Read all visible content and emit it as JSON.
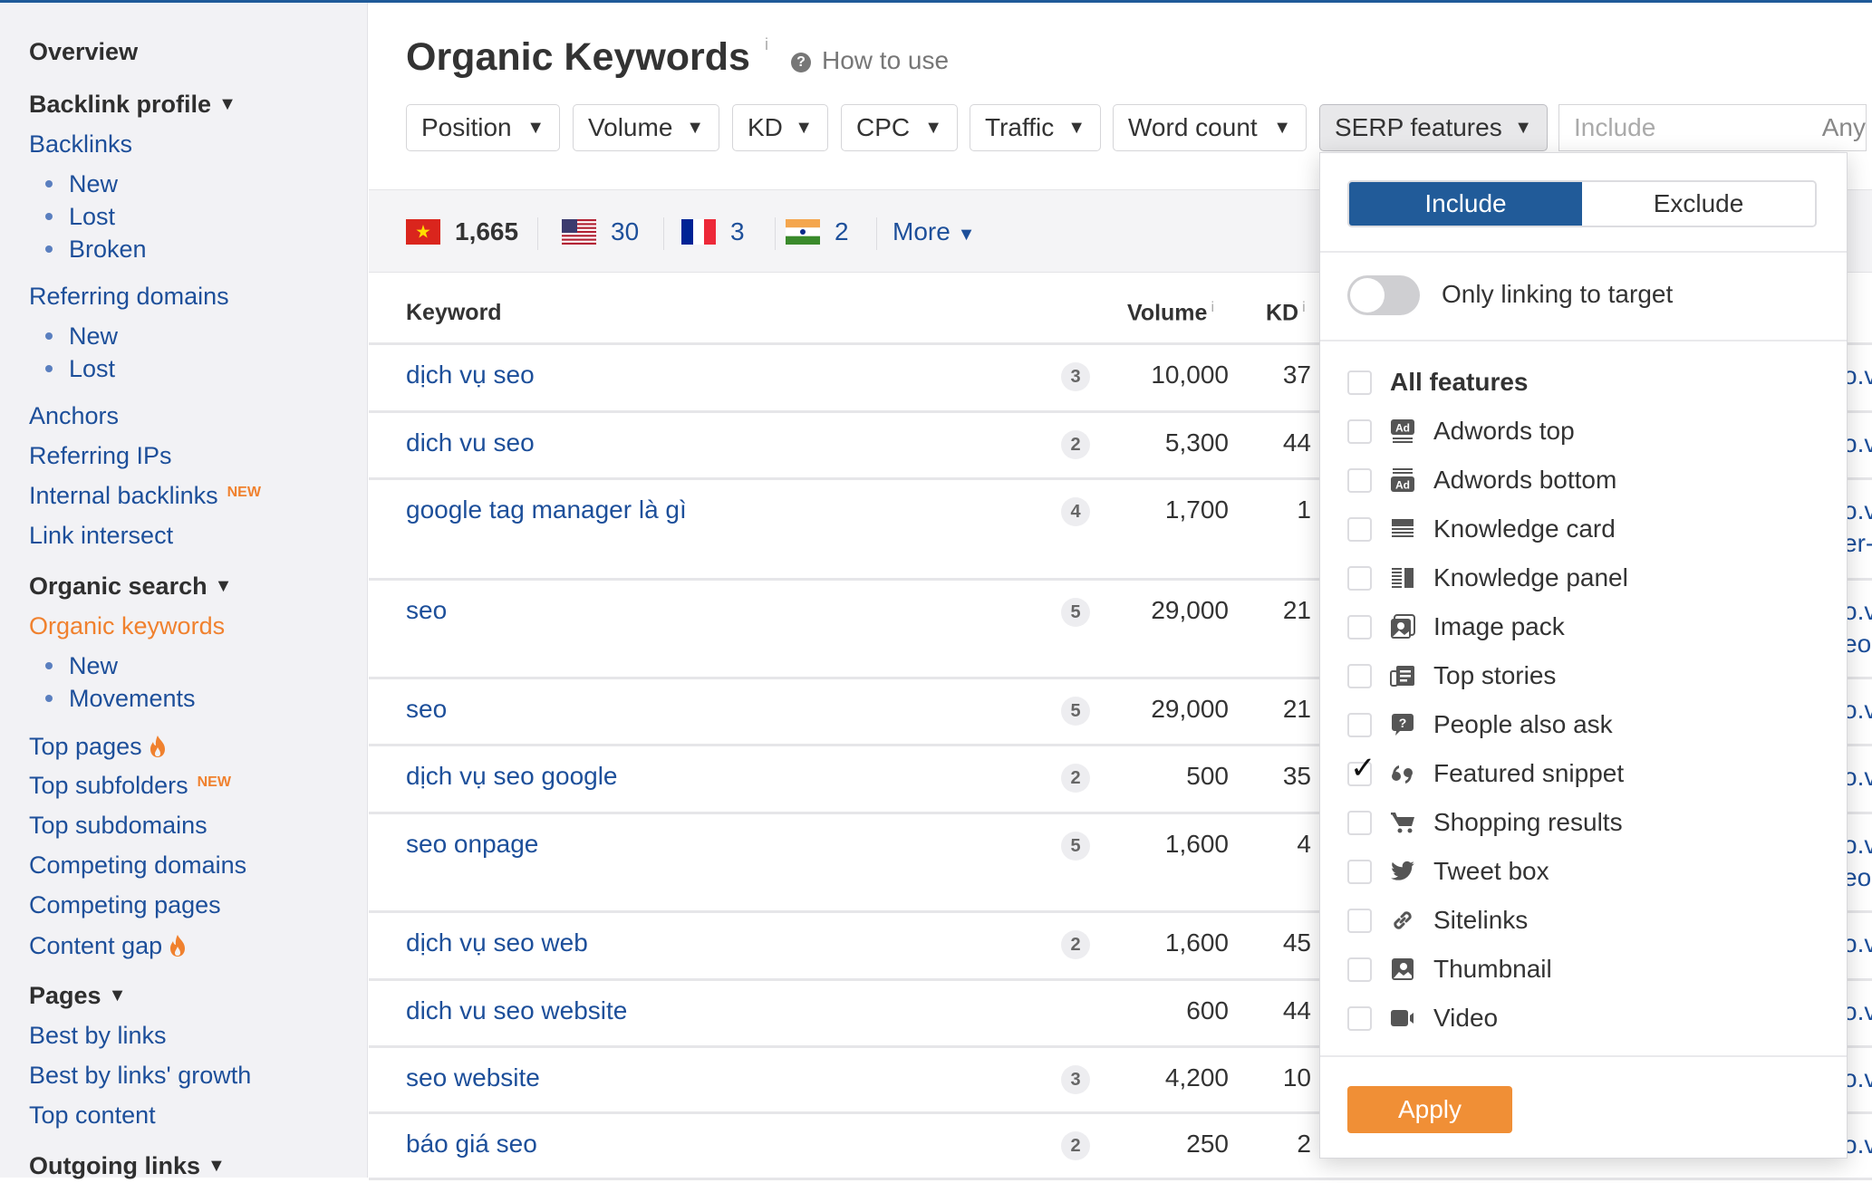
{
  "sidebar": {
    "overview": "Overview",
    "backlink_profile": "Backlink profile",
    "backlinks": "Backlinks",
    "backlinks_sub": [
      "New",
      "Lost",
      "Broken"
    ],
    "referring_domains": "Referring domains",
    "referring_domains_sub": [
      "New",
      "Lost"
    ],
    "anchors": "Anchors",
    "referring_ips": "Referring IPs",
    "internal_backlinks": "Internal backlinks",
    "new_badge": "NEW",
    "link_intersect": "Link intersect",
    "organic_search": "Organic search",
    "organic_keywords": "Organic keywords",
    "organic_keywords_sub": [
      "New",
      "Movements"
    ],
    "top_pages": "Top pages",
    "top_subfolders": "Top subfolders",
    "top_subdomains": "Top subdomains",
    "competing_domains": "Competing domains",
    "competing_pages": "Competing pages",
    "content_gap": "Content gap",
    "pages": "Pages",
    "best_by_links": "Best by links",
    "best_by_links_growth": "Best by links' growth",
    "top_content": "Top content",
    "outgoing_links": "Outgoing links"
  },
  "header": {
    "title": "Organic Keywords",
    "info": "i",
    "how_to_use": "How to use"
  },
  "filters": {
    "position": "Position",
    "volume": "Volume",
    "kd": "KD",
    "cpc": "CPC",
    "traffic": "Traffic",
    "word_count": "Word count",
    "serp_features": "SERP features",
    "include_placeholder": "Include",
    "any": "Any"
  },
  "countries": [
    {
      "code": "vn",
      "count": "1,665"
    },
    {
      "code": "us",
      "count": "30"
    },
    {
      "code": "fr",
      "count": "3"
    },
    {
      "code": "in",
      "count": "2"
    }
  ],
  "more": "More",
  "table": {
    "headers": {
      "keyword": "Keyword",
      "volume": "Volume",
      "kd": "KD",
      "info": "i"
    },
    "rows": [
      {
        "keyword": "dịch vụ seo",
        "serp": "3",
        "volume": "10,000",
        "kd": "37",
        "url": [
          "o.v"
        ]
      },
      {
        "keyword": "dich vu seo",
        "serp": "2",
        "volume": "5,300",
        "kd": "44",
        "url": [
          "o.v"
        ]
      },
      {
        "keyword": "google tag manager là gì",
        "serp": "4",
        "volume": "1,700",
        "kd": "1",
        "url": [
          "o.v",
          "er-"
        ]
      },
      {
        "keyword": "seo",
        "serp": "5",
        "volume": "29,000",
        "kd": "21",
        "url": [
          "o.v",
          "eo"
        ]
      },
      {
        "keyword": "seo",
        "serp": "5",
        "volume": "29,000",
        "kd": "21",
        "url": [
          "o.v"
        ]
      },
      {
        "keyword": "dịch vụ seo google",
        "serp": "2",
        "volume": "500",
        "kd": "35",
        "url": [
          "o.v"
        ]
      },
      {
        "keyword": "seo onpage",
        "serp": "5",
        "volume": "1,600",
        "kd": "4",
        "url": [
          "o.v",
          "eo"
        ]
      },
      {
        "keyword": "dịch vụ seo web",
        "serp": "2",
        "volume": "1,600",
        "kd": "45",
        "url": [
          "o.v"
        ]
      },
      {
        "keyword": "dich vu seo website",
        "serp": "",
        "volume": "600",
        "kd": "44",
        "url": [
          "o.v"
        ]
      },
      {
        "keyword": "seo website",
        "serp": "3",
        "volume": "4,200",
        "kd": "10",
        "url": [
          "o.v"
        ]
      },
      {
        "keyword": "báo giá seo",
        "serp": "2",
        "volume": "250",
        "kd": "2",
        "url": [
          "o.v"
        ]
      }
    ]
  },
  "serp_dropdown": {
    "include": "Include",
    "exclude": "Exclude",
    "mode": "include",
    "only_linking": "Only linking to target",
    "only_linking_on": false,
    "all_features": "All features",
    "features": [
      {
        "label": "Adwords top",
        "icon": "adwords-top-icon",
        "checked": false
      },
      {
        "label": "Adwords bottom",
        "icon": "adwords-bottom-icon",
        "checked": false
      },
      {
        "label": "Knowledge card",
        "icon": "knowledge-card-icon",
        "checked": false
      },
      {
        "label": "Knowledge panel",
        "icon": "knowledge-panel-icon",
        "checked": false
      },
      {
        "label": "Image pack",
        "icon": "image-pack-icon",
        "checked": false
      },
      {
        "label": "Top stories",
        "icon": "top-stories-icon",
        "checked": false
      },
      {
        "label": "People also ask",
        "icon": "people-also-ask-icon",
        "checked": false
      },
      {
        "label": "Featured snippet",
        "icon": "featured-snippet-icon",
        "checked": true
      },
      {
        "label": "Shopping results",
        "icon": "shopping-cart-icon",
        "checked": false
      },
      {
        "label": "Tweet box",
        "icon": "twitter-icon",
        "checked": false
      },
      {
        "label": "Sitelinks",
        "icon": "link-icon",
        "checked": false
      },
      {
        "label": "Thumbnail",
        "icon": "thumbnail-icon",
        "checked": false
      },
      {
        "label": "Video",
        "icon": "video-icon",
        "checked": false
      }
    ],
    "apply": "Apply"
  },
  "colors": {
    "accent_blue": "#215b99",
    "link_blue": "#1d4f9a",
    "active_orange": "#f0812e",
    "apply_orange": "#f08f36"
  }
}
